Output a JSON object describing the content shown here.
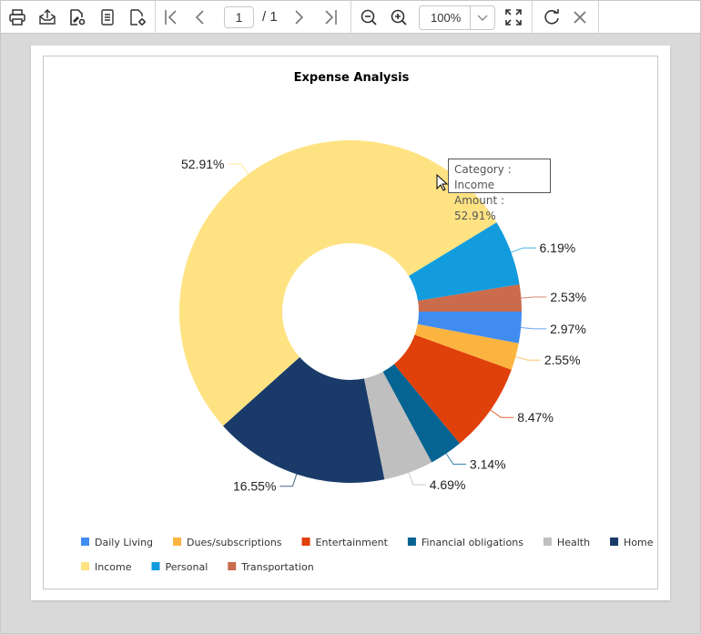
{
  "toolbar": {
    "print": "print-icon",
    "export": "export-icon",
    "edit": "edit-report-icon",
    "parameters": "parameters-icon",
    "page_setup": "page-setup-icon",
    "current_page": "1",
    "total_pages": "/ 1",
    "zoom_value": "100%"
  },
  "tooltip": {
    "line1": "Category : Income",
    "line2": "Amount : 52.91%"
  },
  "chart_data": {
    "type": "pie",
    "subtype": "doughnut",
    "title": "Expense Analysis",
    "legend_position": "bottom",
    "start_angle_deg": 0,
    "direction": "clockwise",
    "categories": [
      "Daily Living",
      "Dues/subscriptions",
      "Entertainment",
      "Financial obligations",
      "Health",
      "Home",
      "Income",
      "Personal",
      "Transportation"
    ],
    "values": [
      2.97,
      2.55,
      8.47,
      3.14,
      4.69,
      16.55,
      52.91,
      6.19,
      2.53
    ],
    "labels": [
      "2.97%",
      "2.55%",
      "8.47%",
      "3.14%",
      "4.69%",
      "16.55%",
      "52.91%",
      "6.19%",
      "2.53%"
    ],
    "colors": [
      "#418CF0",
      "#FCB441",
      "#E0400A",
      "#056492",
      "#BFBFBF",
      "#1A3B69",
      "#FFE382",
      "#129CDD",
      "#CA6B4B"
    ],
    "unit": "%"
  }
}
